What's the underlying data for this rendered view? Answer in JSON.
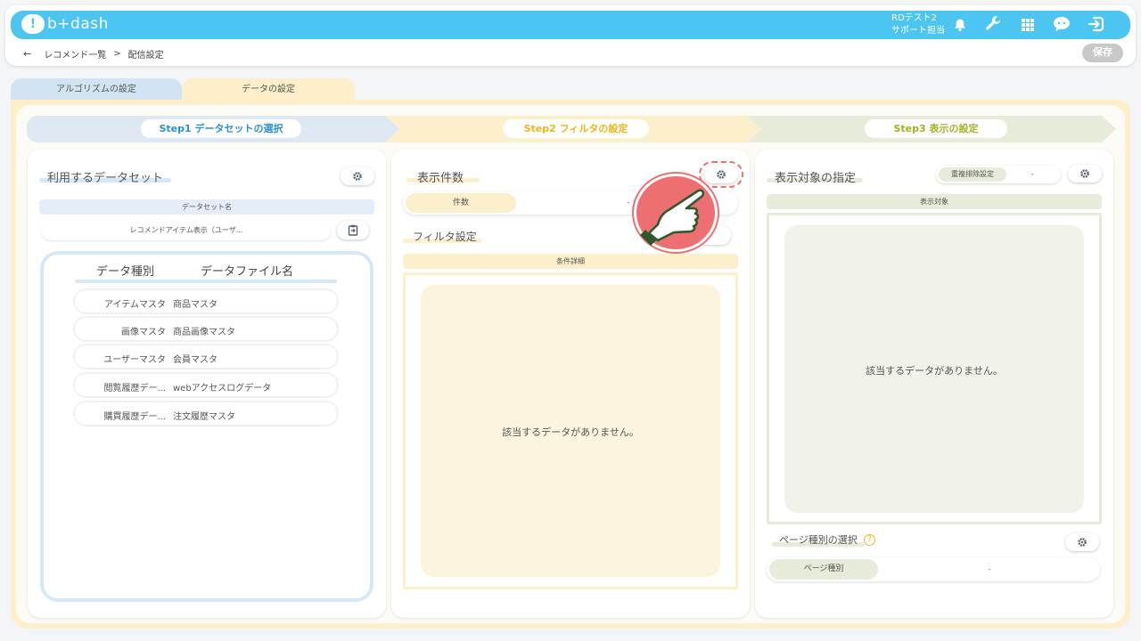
{
  "header": {
    "logo_mark": "!",
    "logo_text": "b+dash",
    "user_line1": "RDテスト2",
    "user_line2": "サポート担当",
    "icons": [
      "bell-icon",
      "wrench-icon",
      "grid-icon",
      "support-chat-icon",
      "logout-icon"
    ]
  },
  "breadcrumb": {
    "back": "←",
    "parent": "レコメンド一覧",
    "sep": ">",
    "current": "配信設定"
  },
  "save_label": "保存",
  "tabs": [
    {
      "label": "アルゴリズムの設定"
    },
    {
      "label": "データの設定"
    }
  ],
  "steps": [
    {
      "label": "Step1 データセットの選択",
      "color": "#2a91d6"
    },
    {
      "label": "Step2 フィルタの設定",
      "color": "#f0b418"
    },
    {
      "label": "Step3 表示の設定",
      "color": "#9cb620"
    }
  ],
  "panel1": {
    "title": "利用するデータセット",
    "dataset_label": "データセット名",
    "dataset_value": "レコメンドアイテム表示（ユーザ...",
    "col_type": "データ種別",
    "col_file": "データファイル名",
    "rows": [
      {
        "type": "アイテムマスタ",
        "name": "商品マスタ"
      },
      {
        "type": "画像マスタ",
        "name": "商品画像マスタ"
      },
      {
        "type": "ユーザーマスタ",
        "name": "会員マスタ"
      },
      {
        "type": "閲覧履歴デー...",
        "name": "webアクセスログデータ"
      },
      {
        "type": "購買履歴デー...",
        "name": "注文履歴マスタ"
      }
    ]
  },
  "panel2": {
    "title": "表示件数",
    "count_label": "件数",
    "count_value": "-",
    "filter_title": "フィルタ設定",
    "condition_label": "条件詳細",
    "empty_text": "該当するデータがありません。"
  },
  "panel3": {
    "title": "表示対象の指定",
    "dedupe_label": "重複排除設定",
    "dedupe_value": "-",
    "target_label": "表示対象",
    "empty_text": "該当するデータがありません。",
    "page_title": "ページ種別の選択",
    "help": "?",
    "page_label": "ページ種別",
    "page_value": "-"
  },
  "colors": {
    "topbar": "#4cc5f0",
    "step1_bg": "#dde8f3",
    "step2_bg": "#fcefcb",
    "step3_bg": "#e6ecd9",
    "pointer_accent": "#ee6f72"
  }
}
